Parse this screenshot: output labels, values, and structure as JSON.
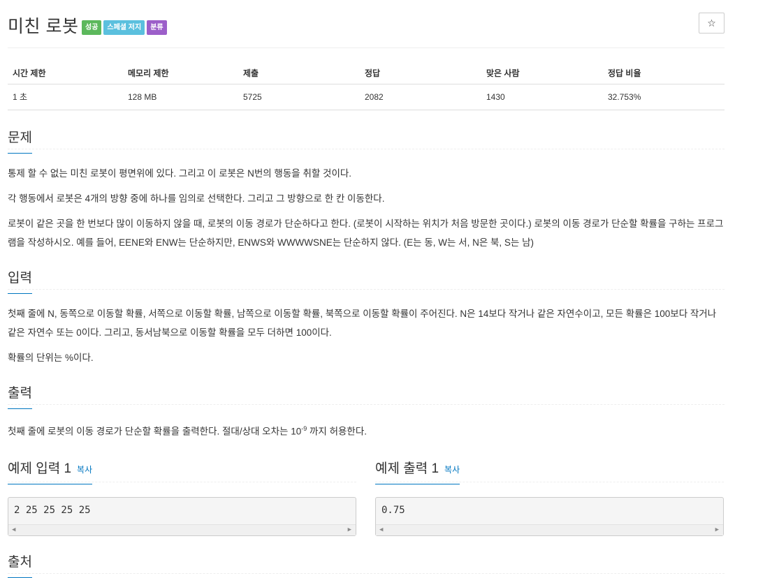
{
  "problem": {
    "title": "미친 로봇",
    "labels": [
      "성공",
      "스페셜 저지",
      "분류"
    ],
    "star": "☆"
  },
  "stats": {
    "headers": [
      "시간 제한",
      "메모리 제한",
      "제출",
      "정답",
      "맞은 사람",
      "정답 비율"
    ],
    "values": [
      "1 초",
      "128 MB",
      "5725",
      "2082",
      "1430",
      "32.753%"
    ]
  },
  "description": {
    "heading": "문제",
    "paragraphs": [
      "통제 할 수 없는 미친 로봇이 평면위에 있다. 그리고 이 로봇은 N번의 행동을 취할 것이다.",
      "각 행동에서 로봇은 4개의 방향 중에 하나를 임의로 선택한다. 그리고 그 방향으로 한 칸 이동한다.",
      "로봇이 같은 곳을 한 번보다 많이 이동하지 않을 때, 로봇의 이동 경로가 단순하다고 한다. (로봇이 시작하는 위치가 처음 방문한 곳이다.) 로봇의 이동 경로가 단순할 확률을 구하는 프로그램을 작성하시오. 예를 들어, EENE와 ENW는 단순하지만, ENWS와 WWWWSNE는 단순하지 않다. (E는 동, W는 서, N은 북, S는 남)"
    ]
  },
  "input": {
    "heading": "입력",
    "paragraphs": [
      "첫째 줄에 N, 동쪽으로 이동할 확률, 서쪽으로 이동할 확률, 남쪽으로 이동할 확률, 북쪽으로 이동할 확률이 주어진다. N은 14보다 작거나 같은 자연수이고,  모든 확률은 100보다 작거나 같은 자연수 또는 0이다. 그리고, 동서남북으로 이동할 확률을 모두 더하면 100이다.",
      "확률의 단위는 %이다."
    ]
  },
  "output": {
    "heading": "출력",
    "text_before": "첫째 줄에 로봇의 이동 경로가 단순할 확률을 출력한다. 절대/상대 오차는 10",
    "exponent": "-9",
    "text_after": " 까지 허용한다."
  },
  "samples": {
    "input": {
      "heading": "예제 입력 1",
      "copy": "복사",
      "content": "2 25 25 25 25"
    },
    "output": {
      "heading": "예제 출력 1",
      "copy": "복사",
      "content": "0.75"
    }
  },
  "source": {
    "heading": "출처"
  }
}
